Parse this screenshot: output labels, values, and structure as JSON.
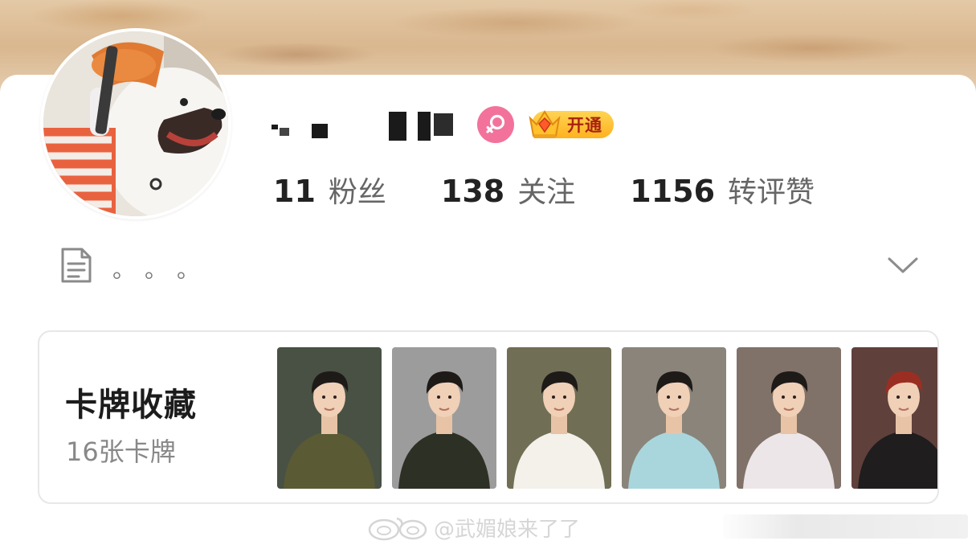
{
  "profile": {
    "gender": "female",
    "vip_label": "开通",
    "avatar_alt": "dog-avatar"
  },
  "stats": [
    {
      "value": "11",
      "label": "粉丝"
    },
    {
      "value": "138",
      "label": "关注"
    },
    {
      "value": "1156",
      "label": "转评赞"
    }
  ],
  "bio": {
    "text": "。。。"
  },
  "collection": {
    "title": "卡牌收藏",
    "count": "16张卡牌",
    "cards": [
      {
        "top": "#2f3a2a",
        "shirt": "#5a5a35"
      },
      {
        "top": "#8f8f8f",
        "shirt": "#2d3024"
      },
      {
        "top": "#5d5a3e",
        "shirt": "#f3f1ea"
      },
      {
        "top": "#7a7468",
        "shirt": "#a9d6dc"
      },
      {
        "top": "#6f5f55",
        "shirt": "#ede6e8"
      },
      {
        "top": "#4a2620",
        "shirt": "#1f1d1e"
      }
    ]
  },
  "watermark": {
    "text": "@武媚娘来了了"
  },
  "colors": {
    "gender_pink": "#f2729c",
    "vip_gold": "#ffb21f"
  }
}
